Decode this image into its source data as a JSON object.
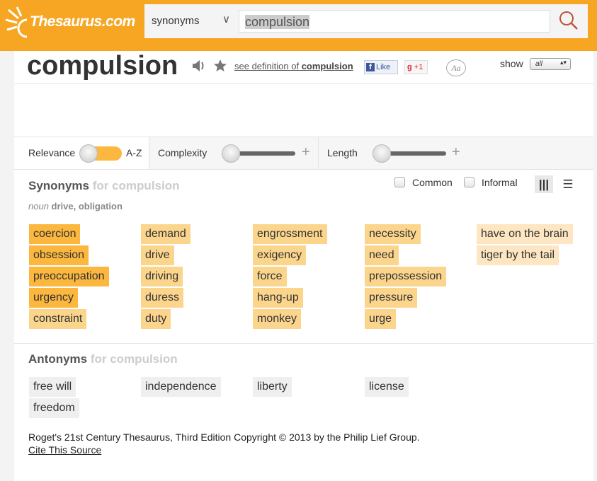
{
  "header": {
    "logo": "Thesaurus.com",
    "search_type": "synonyms",
    "query": "compulsion"
  },
  "word": {
    "title": "compulsion",
    "definition_prefix": "see definition of ",
    "definition_word": "compulsion",
    "like": "Like",
    "gplus": "+1",
    "font_button": "Aa",
    "show_label": "show",
    "show_value": "all"
  },
  "filters": {
    "relevance": "Relevance",
    "az": "A-Z",
    "complexity": "Complexity",
    "length": "Length",
    "plus": "+"
  },
  "synonyms": {
    "title": "Synonyms",
    "for": " for compulsion",
    "pos": "noun",
    "senses": " drive, obligation",
    "common": "Common",
    "informal": "Informal",
    "columns": [
      [
        {
          "w": "coercion",
          "r": 3
        },
        {
          "w": "obsession",
          "r": 3
        },
        {
          "w": "preoccupation",
          "r": 3
        },
        {
          "w": "urgency",
          "r": 3
        },
        {
          "w": "constraint",
          "r": 2
        }
      ],
      [
        {
          "w": "demand",
          "r": 2
        },
        {
          "w": "drive",
          "r": 2
        },
        {
          "w": "driving",
          "r": 2
        },
        {
          "w": "duress",
          "r": 2
        },
        {
          "w": "duty",
          "r": 2
        }
      ],
      [
        {
          "w": "engrossment",
          "r": 2
        },
        {
          "w": "exigency",
          "r": 2
        },
        {
          "w": "force",
          "r": 2
        },
        {
          "w": "hang-up",
          "r": 2
        },
        {
          "w": "monkey",
          "r": 2
        }
      ],
      [
        {
          "w": "necessity",
          "r": 2
        },
        {
          "w": "need",
          "r": 2
        },
        {
          "w": "prepossession",
          "r": 2
        },
        {
          "w": "pressure",
          "r": 2
        },
        {
          "w": "urge",
          "r": 2
        }
      ],
      [
        {
          "w": "have on the brain",
          "r": 1
        },
        {
          "w": "tiger by the tail",
          "r": 1
        }
      ]
    ]
  },
  "antonyms": {
    "title": "Antonyms",
    "for": " for compulsion",
    "columns": [
      [
        "free will",
        "freedom"
      ],
      [
        "independence"
      ],
      [
        "liberty"
      ],
      [
        "license"
      ]
    ]
  },
  "footer": {
    "copyright": "Roget's 21st Century Thesaurus, Third Edition Copyright © 2013 by the Philip Lief Group.",
    "cite": "Cite This Source"
  },
  "colors": {
    "header": "#f6a623",
    "relevance_high": "#fbb73e",
    "relevance_mid": "#fcd58d",
    "relevance_low": "#fde6c1",
    "antonym": "#efefef"
  }
}
